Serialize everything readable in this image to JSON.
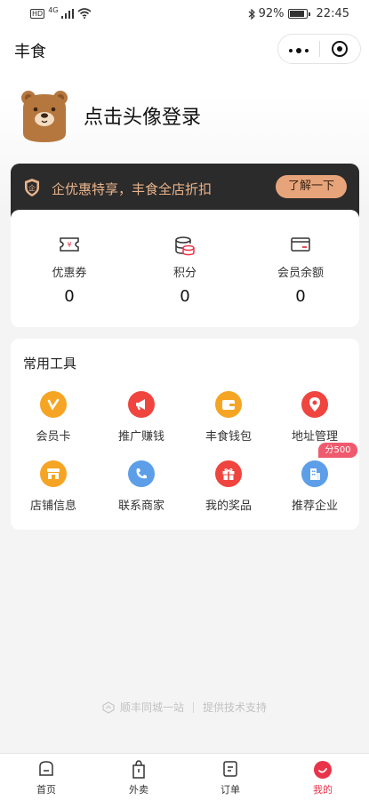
{
  "status_bar": {
    "network_badge": "HD",
    "network_type": "4G",
    "battery": "92%",
    "battery_level": 0.92,
    "time": "22:45"
  },
  "nav": {
    "title": "丰食"
  },
  "profile": {
    "login_prompt": "点击头像登录"
  },
  "vip_banner": {
    "icon_char": "企",
    "text": "企优惠特享，丰食全店折扣",
    "button_label": "了解一下"
  },
  "stats": [
    {
      "label": "优惠券",
      "value": "0",
      "icon": "coupon-icon"
    },
    {
      "label": "积分",
      "value": "0",
      "icon": "points-icon"
    },
    {
      "label": "会员余额",
      "value": "0",
      "icon": "balance-icon"
    }
  ],
  "tools": {
    "title": "常用工具",
    "items": [
      {
        "label": "会员卡",
        "icon": "member-card-icon",
        "color": "#f5a523"
      },
      {
        "label": "推广赚钱",
        "icon": "megaphone-icon",
        "color": "#f0443f"
      },
      {
        "label": "丰食钱包",
        "icon": "wallet-icon",
        "color": "#f5a523"
      },
      {
        "label": "地址管理",
        "icon": "location-icon",
        "color": "#f0443f"
      },
      {
        "label": "店铺信息",
        "icon": "store-icon",
        "color": "#f5a523"
      },
      {
        "label": "联系商家",
        "icon": "phone-icon",
        "color": "#5c9ee8"
      },
      {
        "label": "我的奖品",
        "icon": "gift-icon",
        "color": "#f0443f"
      },
      {
        "label": "推荐企业",
        "icon": "building-icon",
        "color": "#5c9ee8",
        "badge": "分500万"
      }
    ]
  },
  "footer": {
    "brand": "顺丰同城一站",
    "support": "提供技术支持"
  },
  "tabbar": {
    "tabs": [
      {
        "label": "首页",
        "icon": "home-icon"
      },
      {
        "label": "外卖",
        "icon": "takeout-icon"
      },
      {
        "label": "订单",
        "icon": "order-icon"
      },
      {
        "label": "我的",
        "icon": "profile-icon",
        "active": true
      }
    ]
  },
  "colors": {
    "accent": "#e8334a",
    "vip_gold": "#e8b48c",
    "vip_button": "#e7a47a",
    "badge": "#ef5a6f"
  }
}
